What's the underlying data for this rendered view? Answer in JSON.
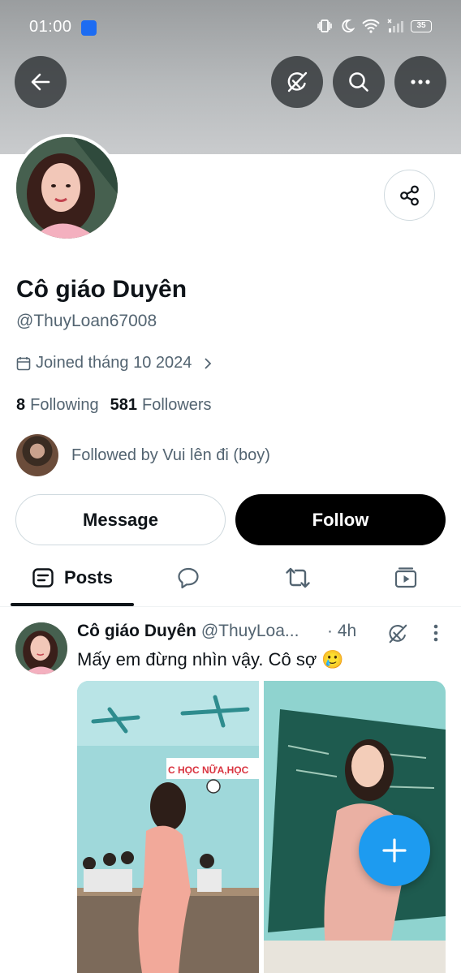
{
  "status_bar": {
    "time": "01:00",
    "battery": "35"
  },
  "profile": {
    "display_name": "Cô giáo Duyên",
    "handle": "@ThuyLoan67008",
    "joined": "Joined tháng 10 2024",
    "following_count": "8",
    "following_label": "Following",
    "followers_count": "581",
    "followers_label": "Followers",
    "followed_by": "Followed by Vui lên đi (boy)"
  },
  "actions": {
    "message_label": "Message",
    "follow_label": "Follow"
  },
  "tabs": {
    "posts_label": "Posts"
  },
  "post": {
    "author": "Cô giáo Duyên",
    "handle": "@ThuyLoa...",
    "separator": " · ",
    "time": "4h",
    "text": "Mấy em đừng nhìn vậy. Cô sợ 🥲",
    "classroom_sign": "C HỌC NỮA,HỌC"
  },
  "colors": {
    "accent": "#1d9bf0",
    "follow_bg": "#000000",
    "secondary_text": "#536471"
  },
  "icons": {
    "back": "arrow-left-icon",
    "grok": "grok-icon",
    "search": "search-icon",
    "more": "more-horizontal-icon",
    "share": "share-icon",
    "calendar": "calendar-icon",
    "fab": "plus-icon"
  }
}
